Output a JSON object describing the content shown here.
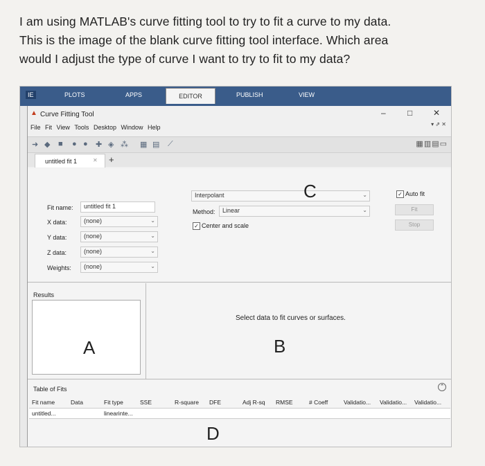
{
  "question": {
    "lines": [
      "I am using MATLAB's curve fitting tool to try to fit a curve to my data.",
      "This is the image of the blank curve fitting tool interface.  Which area",
      "would I adjust the type of curve I want to try to fit to my data?"
    ]
  },
  "ribbon": {
    "tabs": [
      "IE",
      "PLOTS",
      "APPS",
      "EDITOR",
      "PUBLISH",
      "VIEW"
    ]
  },
  "window": {
    "title": "Curve Fitting Tool",
    "controls": {
      "minimize": "–",
      "maximize": "□",
      "close": "✕"
    },
    "dock_controls": "▾ ⇗ ✕",
    "menus": [
      "File",
      "Fit",
      "View",
      "Tools",
      "Desktop",
      "Window",
      "Help"
    ],
    "layout_icons": "▦▥▤▭"
  },
  "doc_tab": {
    "label": "untitled fit 1",
    "close": "✕",
    "add": "+"
  },
  "fit_form": {
    "fit_name_label": "Fit name:",
    "fit_name_value": "untitled fit 1",
    "x_label": "X data:",
    "x_value": "(none)",
    "y_label": "Y data:",
    "y_value": "(none)",
    "z_label": "Z data:",
    "z_value": "(none)",
    "weights_label": "Weights:",
    "weights_value": "(none)"
  },
  "fit_type": {
    "type_value": "Interpolant",
    "method_label": "Method:",
    "method_value": "Linear",
    "center_scale_label": "Center and scale",
    "auto_fit_label": "Auto fit",
    "fit_button": "Fit",
    "stop_button": "Stop"
  },
  "results": {
    "heading": "Results"
  },
  "plot_area": {
    "message": "Select data to fit curves or surfaces."
  },
  "table_of_fits": {
    "heading": "Table of Fits",
    "columns": [
      "Fit name",
      "Data",
      "Fit type",
      "SSE",
      "R-square",
      "DFE",
      "Adj R-sq",
      "RMSE",
      "# Coeff",
      "Validatio...",
      "Validatio...",
      "Validatio..."
    ],
    "row": {
      "fit_name": "untitled...",
      "fit_type": "linearinte..."
    }
  },
  "annotations": {
    "a": "A",
    "b": "B",
    "c": "C",
    "d": "D"
  }
}
